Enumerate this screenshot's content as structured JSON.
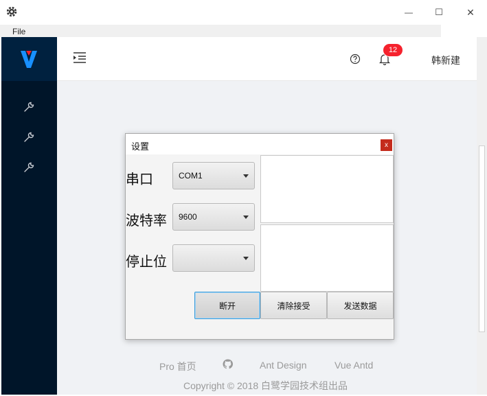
{
  "window": {
    "menu": [
      "File"
    ],
    "minimize_glyph": "—",
    "maximize_glyph": "☐",
    "close_glyph": "✕"
  },
  "sidebar": {
    "items": [
      {
        "icon": "wrench-icon"
      },
      {
        "icon": "wrench-icon"
      },
      {
        "icon": "wrench-icon"
      }
    ]
  },
  "header": {
    "notification_count": "12",
    "username": "韩新建"
  },
  "dialog": {
    "title": "设置",
    "close_label": "x",
    "fields": [
      {
        "label": "串口",
        "value": "COM1"
      },
      {
        "label": "波特率",
        "value": "9600"
      },
      {
        "label": "停止位",
        "value": ""
      }
    ],
    "buttons": {
      "disconnect": "断开",
      "clear": "清除接受",
      "send": "发送数据"
    }
  },
  "footer": {
    "links": [
      "Pro 首页",
      "Ant Design",
      "Vue Antd"
    ],
    "copyright": "Copyright © 2018 白鹭学园技术组出品"
  },
  "colors": {
    "sidebar_bg": "#001529",
    "badge": "#f5222d",
    "logo_blue": "#1890ff",
    "logo_red": "#f5222d"
  }
}
